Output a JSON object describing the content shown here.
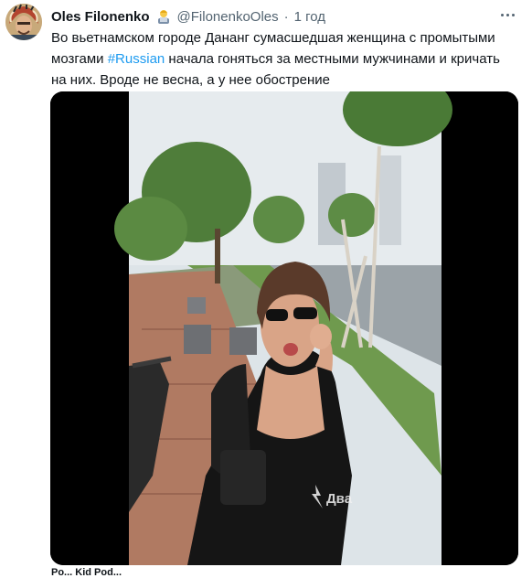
{
  "author": {
    "name": "Oles Filonenko",
    "handle": "@FilonenkoOles",
    "separator": "·",
    "time": "1 год",
    "badge_icon": "man-technologist-emoji"
  },
  "tweet": {
    "text_before": "Во вьетнамском городе Дананг сумасшедшая женщина с промытыми мозгами ",
    "hashtag": "#Russian",
    "text_after": " начала гоняться за местными мужчинами и кричать на них. Вроде не весна, а у нее обострение"
  },
  "video": {
    "watermark": "Два"
  },
  "next_tweet_peek": "Po... Kid Pod..."
}
